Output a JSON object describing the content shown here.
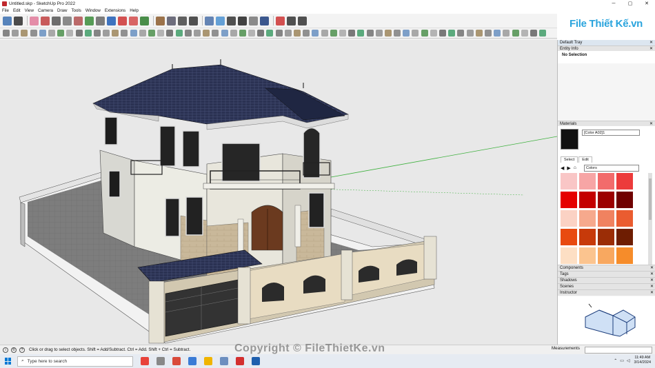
{
  "window": {
    "title": "Untitled.skp - SketchUp Pro 2022",
    "minimize": "─",
    "maximize": "▢",
    "close": "✕"
  },
  "menu": [
    "File",
    "Edit",
    "View",
    "Camera",
    "Draw",
    "Tools",
    "Window",
    "Extensions",
    "Help"
  ],
  "brand": {
    "logo": "File Thiết Kế.vn",
    "accent": "#2aa4dd"
  },
  "toolbar1_icons": [
    "zoom-icon",
    "select-arrow-icon",
    "eraser-icon",
    "paint-icon",
    "pencil-icon",
    "line-icon",
    "arc-icon",
    "shape-icon",
    "rectangle-icon",
    "pushpull-icon",
    "move-icon",
    "rotate-icon",
    "scale-icon",
    "offset-icon",
    "tape-icon",
    "text-icon",
    "axes-icon",
    "orbit-icon",
    "pan-icon",
    "zoom-window-icon",
    "zoom-extents-icon",
    "prev-view-icon",
    "section-icon",
    "warehouse-icon",
    "extension-icon",
    "user-icon"
  ],
  "toolbar2_icons": [
    "tool-1-icon",
    "tool-2-icon",
    "tool-3-icon",
    "tool-4-icon",
    "tool-5-icon",
    "tool-6-icon",
    "tool-7-icon",
    "tool-8-icon",
    "tool-9-icon",
    "tool-10-icon",
    "tool-11-icon",
    "tool-12-icon",
    "tool-13-icon",
    "tool-14-icon",
    "tool-15-icon",
    "tool-16-icon",
    "tool-17-icon",
    "tool-18-icon",
    "tool-19-icon",
    "tool-20-icon",
    "tool-21-icon",
    "tool-22-icon",
    "tool-23-icon",
    "tool-24-icon",
    "tool-25-icon",
    "tool-26-icon",
    "tool-27-icon",
    "tool-28-icon",
    "tool-29-icon",
    "tool-30-icon",
    "tool-31-icon",
    "tool-32-icon",
    "tool-33-icon",
    "tool-34-icon",
    "tool-35-icon",
    "tool-36-icon",
    "tool-37-icon",
    "tool-38-icon",
    "tool-39-icon",
    "tool-40-icon",
    "tool-41-icon",
    "tool-42-icon",
    "tool-43-icon",
    "tool-44-icon",
    "tool-45-icon",
    "tool-46-icon",
    "tool-47-icon",
    "tool-48-icon",
    "tool-49-icon",
    "tool-50-icon",
    "tool-51-icon",
    "tool-52-icon",
    "tool-53-icon",
    "tool-54-icon",
    "tool-55-icon",
    "tool-56-icon",
    "tool-57-icon",
    "tool-58-icon",
    "tool-59-icon",
    "tool-60-icon"
  ],
  "tray": {
    "title": "Default Tray",
    "entity_info": {
      "header": "Entity Info",
      "value": "No Selection"
    },
    "materials": {
      "header": "Materials",
      "name": "[Color A02]1",
      "tabs": [
        "Select",
        "Edit"
      ],
      "collection": "Colors",
      "swatches": [
        "#f9c6c6",
        "#f7a5a5",
        "#f26b6b",
        "#ec3b3b",
        "#e50000",
        "#c40000",
        "#9c0000",
        "#700000",
        "#fbd2c4",
        "#f6a98d",
        "#f08260",
        "#ea5c30",
        "#e84a10",
        "#c73a0a",
        "#9b2d06",
        "#6e1d02",
        "#fddfc4",
        "#fbc48f",
        "#f8a860",
        "#f68c2a",
        "#f07a10",
        "#d96a08",
        "#b25806",
        "#874204"
      ]
    },
    "panels": [
      "Components",
      "Tags",
      "Shadows",
      "Scenes",
      "Instructor"
    ]
  },
  "status": {
    "message": "Click or drag to select objects. Shift = Add/Subtract. Ctrl = Add. Shift + Ctrl = Subtract.",
    "measurements_label": "Measurements",
    "watermark": "Copyright © FileThietKe.vn"
  },
  "taskbar": {
    "search_placeholder": "Type here to search",
    "apps": [
      "#e8423a",
      "#888888",
      "#d94a3a",
      "#3a7bd5",
      "#f0b400",
      "#6c8ebf",
      "#d32f2f",
      "#1e5fae"
    ],
    "time": "11:49 AM",
    "date": "3/14/2024"
  }
}
